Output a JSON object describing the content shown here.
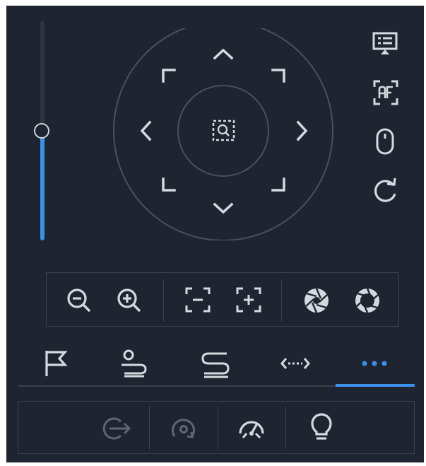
{
  "colors": {
    "panel_bg": "#1e2530",
    "icon": "#d5d9df",
    "icon_dim": "#5f6672",
    "accent": "#3a8fe8",
    "border": "#3a414d"
  },
  "zoom_slider": {
    "level": 0.5
  },
  "ptz_pad": {
    "center": "area-zoom-icon",
    "directions": [
      "up",
      "down",
      "left",
      "right",
      "up-left",
      "up-right",
      "down-left",
      "down-right"
    ]
  },
  "side_tools": [
    "osd-menu-icon",
    "auto-focus-icon",
    "mouse-icon",
    "refresh-icon"
  ],
  "lens_controls": [
    [
      "zoom-out-icon",
      "zoom-in-icon"
    ],
    [
      "focus-near-icon",
      "focus-far-icon"
    ],
    [
      "iris-close-icon",
      "iris-open-icon"
    ]
  ],
  "tabs": {
    "items": [
      "preset-flag-icon",
      "tour-icon",
      "pattern-icon",
      "pan-icon",
      "more-icon"
    ],
    "active_index": 4
  },
  "extra_tools": [
    "go-home-icon",
    "rotate-icon",
    "speed-icon",
    "light-icon"
  ],
  "extra_tools_enabled": [
    false,
    false,
    true,
    true
  ]
}
